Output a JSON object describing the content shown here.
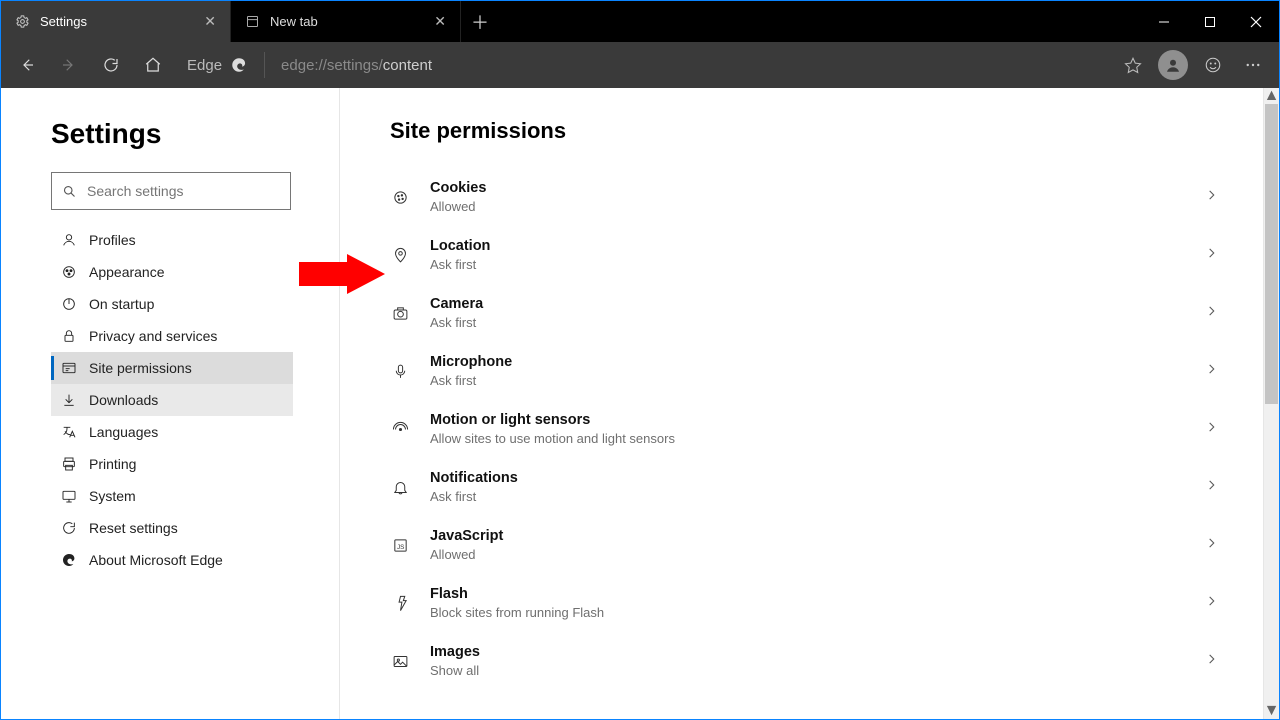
{
  "tabs": [
    {
      "title": "Settings",
      "active": true
    },
    {
      "title": "New tab",
      "active": false
    }
  ],
  "toolbar": {
    "edge_label": "Edge",
    "url_dim": "edge://settings/",
    "url_bright": "content"
  },
  "sidebar": {
    "heading": "Settings",
    "search_placeholder": "Search settings",
    "items": [
      {
        "label": "Profiles",
        "icon": "person"
      },
      {
        "label": "Appearance",
        "icon": "appearance"
      },
      {
        "label": "On startup",
        "icon": "power"
      },
      {
        "label": "Privacy and services",
        "icon": "lock"
      },
      {
        "label": "Site permissions",
        "icon": "site",
        "selected": true
      },
      {
        "label": "Downloads",
        "icon": "download",
        "hover": true
      },
      {
        "label": "Languages",
        "icon": "lang"
      },
      {
        "label": "Printing",
        "icon": "print"
      },
      {
        "label": "System",
        "icon": "system"
      },
      {
        "label": "Reset settings",
        "icon": "reset"
      },
      {
        "label": "About Microsoft Edge",
        "icon": "edge"
      }
    ]
  },
  "main": {
    "heading": "Site permissions",
    "rows": [
      {
        "title": "Cookies",
        "sub": "Allowed",
        "icon": "cookie"
      },
      {
        "title": "Location",
        "sub": "Ask first",
        "icon": "location"
      },
      {
        "title": "Camera",
        "sub": "Ask first",
        "icon": "camera"
      },
      {
        "title": "Microphone",
        "sub": "Ask first",
        "icon": "mic"
      },
      {
        "title": "Motion or light sensors",
        "sub": "Allow sites to use motion and light sensors",
        "icon": "motion"
      },
      {
        "title": "Notifications",
        "sub": "Ask first",
        "icon": "bell"
      },
      {
        "title": "JavaScript",
        "sub": "Allowed",
        "icon": "js"
      },
      {
        "title": "Flash",
        "sub": "Block sites from running Flash",
        "icon": "flash"
      },
      {
        "title": "Images",
        "sub": "Show all",
        "icon": "image"
      }
    ]
  }
}
